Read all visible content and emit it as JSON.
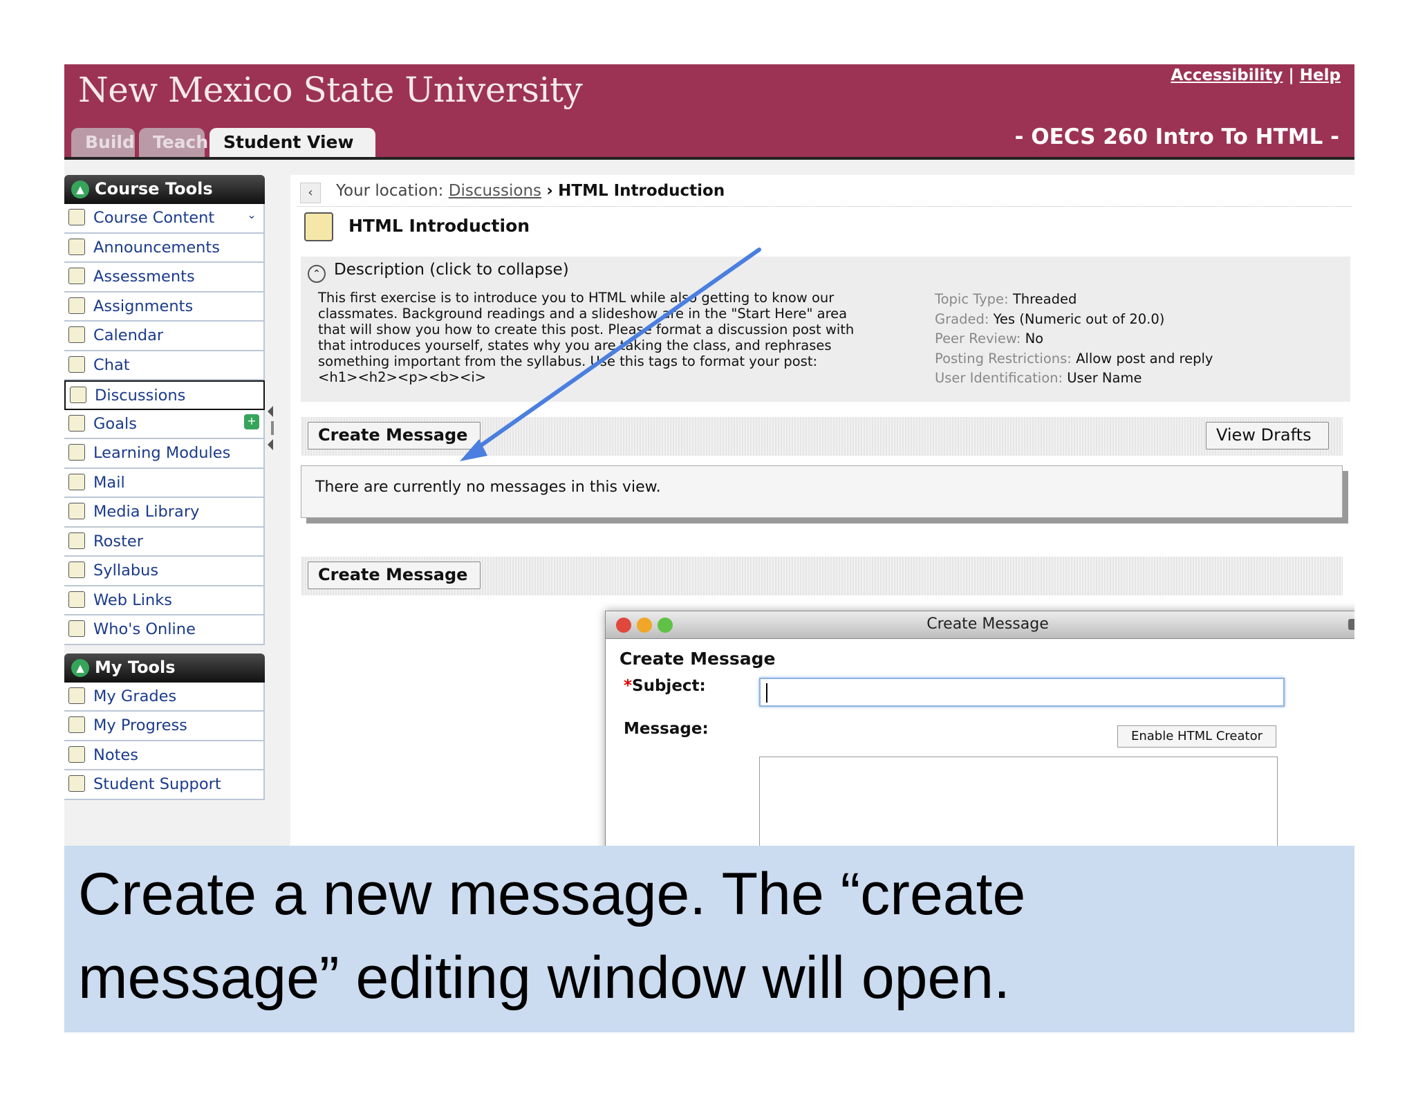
{
  "header": {
    "university": "New Mexico State University",
    "links": [
      "Accessibility",
      "Help"
    ],
    "link_separator": "|",
    "course_title": "- OECS 260 Intro To HTML -",
    "tabs": [
      {
        "label": "Build",
        "active": false
      },
      {
        "label": "Teach",
        "active": false
      },
      {
        "label": "Student View",
        "active": true
      }
    ],
    "color": "#9c3355"
  },
  "sidebar": {
    "course_tools_title": "Course Tools",
    "course_tools": [
      {
        "label": "Course Content",
        "icon": "home-icon"
      },
      {
        "label": "Announcements",
        "icon": "megaphone-icon"
      },
      {
        "label": "Assessments",
        "icon": "assessments-icon"
      },
      {
        "label": "Assignments",
        "icon": "assignments-icon"
      },
      {
        "label": "Calendar",
        "icon": "calendar-icon"
      },
      {
        "label": "Chat",
        "icon": "chat-icon"
      },
      {
        "label": "Discussions",
        "icon": "discussions-icon",
        "selected": true
      },
      {
        "label": "Goals",
        "icon": "goals-icon"
      },
      {
        "label": "Learning Modules",
        "icon": "modules-icon"
      },
      {
        "label": "Mail",
        "icon": "mail-icon"
      },
      {
        "label": "Media Library",
        "icon": "media-library-icon"
      },
      {
        "label": "Roster",
        "icon": "roster-icon"
      },
      {
        "label": "Syllabus",
        "icon": "syllabus-icon"
      },
      {
        "label": "Web Links",
        "icon": "globe-icon"
      },
      {
        "label": "Who's Online",
        "icon": "whos-online-icon"
      }
    ],
    "my_tools_title": "My Tools",
    "my_tools": [
      {
        "label": "My Grades",
        "icon": "grades-icon"
      },
      {
        "label": "My Progress",
        "icon": "progress-icon"
      },
      {
        "label": "Notes",
        "icon": "notes-icon"
      },
      {
        "label": "Student Support",
        "icon": "nmstate-logo-icon"
      }
    ]
  },
  "main": {
    "location_label": "Your location:",
    "location_link": "Discussions",
    "location_sep": "›",
    "location_current": "HTML Introduction",
    "page_title": "HTML Introduction",
    "description_header": "Description (click to collapse)",
    "description_lines": [
      "This first exercise is to introduce you to HTML while also getting to know our",
      "classmates. Background readings and a slideshow are in the \"Start Here\" area",
      "that will show you how to create this post. Please format a discussion post with",
      "that introduces yourself, states why you are taking the class, and rephrases",
      "something important from the syllabus. Use this tags to format your post:",
      "<h1><h2><p><b><i>"
    ],
    "meta": [
      {
        "key": "Topic Type:",
        "value": "Threaded"
      },
      {
        "key": "Graded:",
        "value": "Yes (Numeric out of 20.0)"
      },
      {
        "key": "Peer Review:",
        "value": "No"
      },
      {
        "key": "Posting Restrictions:",
        "value": "Allow post and reply"
      },
      {
        "key": "User Identification:",
        "value": "User Name"
      }
    ],
    "create_message_label": "Create Message",
    "view_drafts_label": "View Drafts",
    "empty_text": "There are currently no messages in this view."
  },
  "dialog": {
    "window_title": "Create Message",
    "heading": "Create Message",
    "required_mark": "*",
    "subject_label": "Subject:",
    "subject_value": "",
    "message_label": "Message:",
    "enable_html_label": "Enable HTML Creator",
    "message_value": ""
  },
  "caption": {
    "line1": "Create a new message. The “create",
    "line2": "message” editing window will open.",
    "background": "#cbdbf0"
  },
  "annotation": {
    "arrow_color": "#4a7fe0"
  }
}
